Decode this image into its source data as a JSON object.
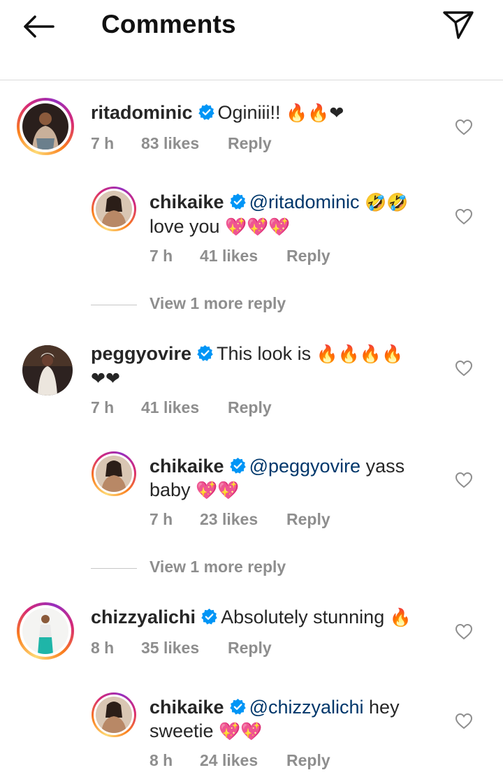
{
  "header": {
    "title": "Comments",
    "back_icon": "arrow-left-icon",
    "share_icon": "paper-plane-icon"
  },
  "comments": [
    {
      "username": "ritadominic",
      "verified": true,
      "text": "Oginiii!! ",
      "emoji": "🔥🔥❤",
      "time": "7 h",
      "likes": "83 likes",
      "reply_label": "Reply",
      "replies": [
        {
          "username": "chikaike",
          "verified": true,
          "mention": "@ritadominic",
          "emoji_1": "🤣🤣",
          "text_2": "love you ",
          "emoji_2": "💖💖💖",
          "time": "7 h",
          "likes": "41 likes",
          "reply_label": "Reply"
        }
      ],
      "view_more": "View 1 more reply"
    },
    {
      "username": "peggyovire",
      "verified": true,
      "text": "This look is ",
      "emoji": "🔥🔥🔥🔥",
      "emoji_2": "❤❤",
      "time": "7 h",
      "likes": "41 likes",
      "reply_label": "Reply",
      "replies": [
        {
          "username": "chikaike",
          "verified": true,
          "mention": "@peggyovire",
          "text_1": " yass",
          "text_2": "baby ",
          "emoji_2": "💖💖",
          "time": "7 h",
          "likes": "23 likes",
          "reply_label": "Reply"
        }
      ],
      "view_more": "View 1 more reply"
    },
    {
      "username": "chizzyalichi",
      "verified": true,
      "text": "Absolutely stunning ",
      "emoji": "🔥",
      "time": "8 h",
      "likes": "35 likes",
      "reply_label": "Reply",
      "replies": [
        {
          "username": "chikaike",
          "verified": true,
          "mention": "@chizzyalichi",
          "text_1": " hey",
          "text_2": "sweetie ",
          "emoji_2": "💖💖",
          "time": "8 h",
          "likes": "24 likes",
          "reply_label": "Reply"
        }
      ]
    }
  ],
  "colors": {
    "verified": "#0095f6",
    "mention": "#00376b",
    "meta": "#8e8e8e",
    "text": "#262626"
  }
}
